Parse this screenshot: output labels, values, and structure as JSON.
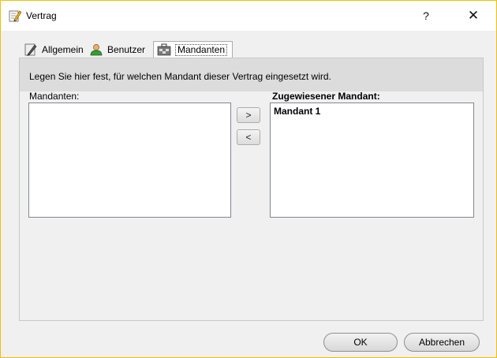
{
  "window": {
    "title": "Vertrag",
    "help_label": "?",
    "close_label": "✕"
  },
  "tabs": [
    {
      "label": "Allgemein",
      "icon": "pen-icon",
      "selected": false
    },
    {
      "label": "Benutzer",
      "icon": "user-icon",
      "selected": false
    },
    {
      "label": "Mandanten",
      "icon": "clients-icon",
      "selected": true
    }
  ],
  "panel": {
    "hint": "Legen Sie hier fest, für welchen Mandant dieser Vertrag eingesetzt wird.",
    "available_label": "Mandanten:",
    "assigned_label": "Zugewiesener Mandant:",
    "available_items": [],
    "assigned_items": [
      "Mandant 1"
    ],
    "move_right_label": ">",
    "move_left_label": "<"
  },
  "footer": {
    "ok_label": "OK",
    "cancel_label": "Abbrechen"
  },
  "colors": {
    "window_border": "#f0c000",
    "panel_header": "#dcdcdc"
  }
}
